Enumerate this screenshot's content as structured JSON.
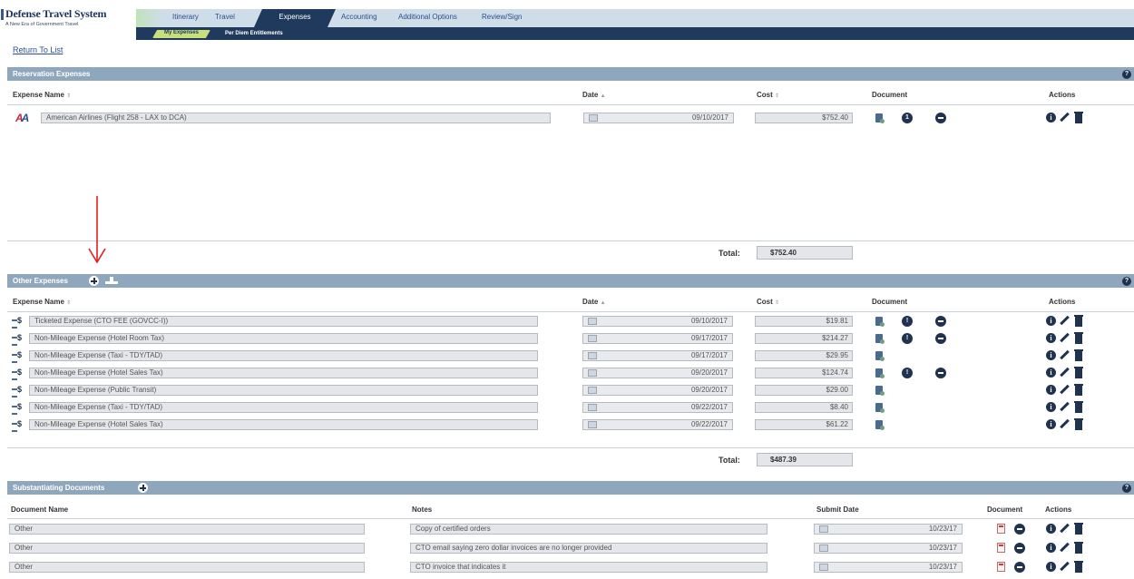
{
  "app": {
    "title": "Defense Travel System",
    "subtitle": "A New Era of Government Travel"
  },
  "nav": {
    "tabs": [
      "Itinerary",
      "Travel",
      "Expenses",
      "Accounting",
      "Additional Options",
      "Review/Sign"
    ],
    "active": "Expenses",
    "subtabs": [
      "My Expenses",
      "Per Diem Entitlements"
    ]
  },
  "return_link": "Return To List",
  "reservation": {
    "title": "Reservation Expenses",
    "columns": {
      "name": "Expense Name",
      "date": "Date",
      "cost": "Cost",
      "document": "Document",
      "actions": "Actions"
    },
    "rows": [
      {
        "name": "American Airlines (Flight 258 - LAX to DCA)",
        "date": "09/10/2017",
        "cost": "$752.40",
        "badge": "1"
      }
    ],
    "total_label": "Total:",
    "total": "$752.40"
  },
  "other": {
    "title": "Other Expenses",
    "columns": {
      "name": "Expense Name",
      "date": "Date",
      "cost": "Cost",
      "document": "Document",
      "actions": "Actions"
    },
    "rows": [
      {
        "name": "Ticketed Expense (CTO FEE (GOVCC-I))",
        "date": "09/10/2017",
        "cost": "$19.81",
        "badge": true
      },
      {
        "name": "Non-Mileage Expense (Hotel Room Tax)",
        "date": "09/17/2017",
        "cost": "$214.27",
        "badge": true
      },
      {
        "name": "Non-Mileage Expense (Taxi - TDY/TAD)",
        "date": "09/17/2017",
        "cost": "$29.95",
        "badge": false
      },
      {
        "name": "Non-Mileage Expense (Hotel Sales Tax)",
        "date": "09/20/2017",
        "cost": "$124.74",
        "badge": true
      },
      {
        "name": "Non-Mileage Expense (Public Transit)",
        "date": "09/20/2017",
        "cost": "$29.00",
        "badge": false
      },
      {
        "name": "Non-Mileage Expense (Taxi - TDY/TAD)",
        "date": "09/22/2017",
        "cost": "$8.40",
        "badge": false
      },
      {
        "name": "Non-Mileage Expense (Hotel Sales Tax)",
        "date": "09/22/2017",
        "cost": "$61.22",
        "badge": false
      }
    ],
    "total_label": "Total:",
    "total": "$487.39"
  },
  "docs": {
    "title": "Substantiating Documents",
    "columns": {
      "name": "Document Name",
      "notes": "Notes",
      "submit": "Submit Date",
      "document": "Document",
      "actions": "Actions"
    },
    "rows": [
      {
        "name": "Other",
        "notes": "Copy of certified orders",
        "date": "10/23/17"
      },
      {
        "name": "Other",
        "notes": "CTO email saying zero dollar invoices are no longer provided",
        "date": "10/23/17"
      },
      {
        "name": "Other",
        "notes": "CTO invoice that indicates it",
        "date": "10/23/17"
      }
    ]
  },
  "colors": {
    "header_bar": "#8fa7bd",
    "nav_dark": "#1f3a5c",
    "accent_red": "#e02020"
  }
}
